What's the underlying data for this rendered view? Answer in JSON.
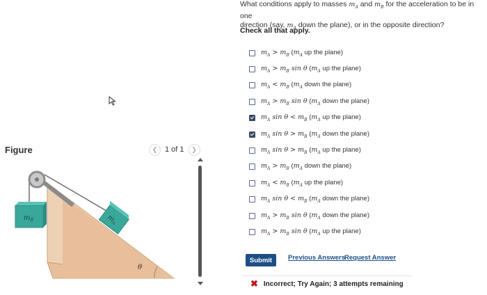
{
  "figure": {
    "label": "Figure",
    "pager_text": "1 of 1",
    "prev_icon": "chevron-left-icon",
    "next_icon": "chevron-right-icon",
    "mass_a_label": "m",
    "mass_a_sub": "A",
    "mass_b_label": "m",
    "mass_b_sub": "B",
    "angle_label": "θ"
  },
  "question": {
    "line1_a": "What conditions apply to masses ",
    "line1_b": " and ",
    "line1_c": " for the acceleration to be in one",
    "line2_a": "direction (say, ",
    "line2_b": " down the plane), or in the opposite direction?",
    "check_all": "Check all that apply."
  },
  "options": [
    {
      "math": "m_A > m_B",
      "text": "(m_A up the plane)",
      "checked": false
    },
    {
      "math": "m_A > m_B sin θ",
      "text": "(m_A up the plane)",
      "checked": false
    },
    {
      "math": "m_A < m_B",
      "text": "(m_A down the plane)",
      "checked": false
    },
    {
      "math": "m_A > m_B sin θ",
      "text": "(m_A down the plane)",
      "checked": false
    },
    {
      "math": "m_A sin θ < m_B",
      "text": "(m_A up the plane)",
      "checked": true
    },
    {
      "math": "m_A sin θ > m_B",
      "text": "(m_A down the plane)",
      "checked": true
    },
    {
      "math": "m_A sin θ > m_B",
      "text": "(m_A up the plane)",
      "checked": false
    },
    {
      "math": "m_A > m_B",
      "text": "(m_A down the plane)",
      "checked": false
    },
    {
      "math": "m_A < m_B",
      "text": "(m_A up the plane)",
      "checked": false
    },
    {
      "math": "m_A sin θ < m_B",
      "text": "(m_A down the plane)",
      "checked": false
    },
    {
      "math": "m_A > m_B sin θ",
      "text": "(m_A down the plane)",
      "checked": false
    },
    {
      "math": "m_A > m_B sin θ",
      "text": "(m_A up the plane)",
      "checked": false
    }
  ],
  "actions": {
    "submit": "Submit",
    "previous_answers": "Previous Answers",
    "request_answer": "Request Answer"
  },
  "feedback": {
    "icon": "x-icon",
    "text": "Incorrect; Try Again; 3 attempts remaining"
  },
  "colors": {
    "submit_bg": "#1d4f87",
    "checkbox_checked": "#3d4a66",
    "block_teal": "#3aa79b",
    "incline": "#e8bf9a",
    "error": "#c0161c"
  }
}
